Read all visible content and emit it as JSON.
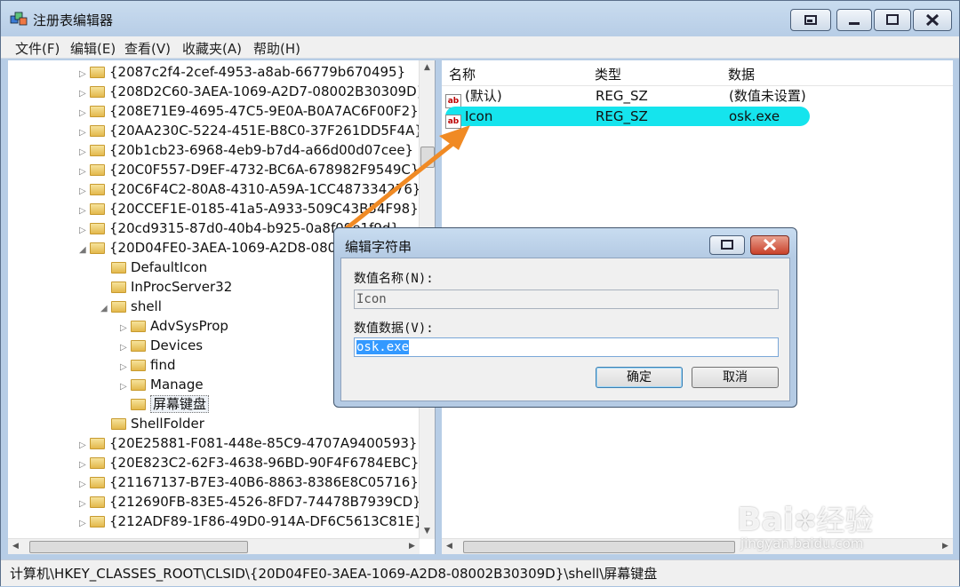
{
  "window": {
    "title": "注册表编辑器"
  },
  "menu": [
    "文件(F)",
    "编辑(E)",
    "查看(V)",
    "收藏夹(A)",
    "帮助(H)"
  ],
  "tree": [
    {
      "label": "{2087c2f4-2cef-4953-a8ab-66779b670495}",
      "level": 0,
      "arrow": "▷"
    },
    {
      "label": "{208D2C60-3AEA-1069-A2D7-08002B30309D}",
      "level": 0,
      "arrow": "▷"
    },
    {
      "label": "{208E71E9-4695-47C5-9E0A-B0A7AC6F00F2}",
      "level": 0,
      "arrow": "▷"
    },
    {
      "label": "{20AA230C-5224-451E-B8C0-37F261DD5F4A}",
      "level": 0,
      "arrow": "▷"
    },
    {
      "label": "{20b1cb23-6968-4eb9-b7d4-a66d00d07cee}",
      "level": 0,
      "arrow": "▷"
    },
    {
      "label": "{20C0F557-D9EF-4732-BC6A-678982F9549C}",
      "level": 0,
      "arrow": "▷"
    },
    {
      "label": "{20C6F4C2-80A8-4310-A59A-1CC487334276}",
      "level": 0,
      "arrow": "▷"
    },
    {
      "label": "{20CCEF1E-0185-41a5-A933-509C43B54F98}",
      "level": 0,
      "arrow": "▷"
    },
    {
      "label": "{20cd9315-87d0-40b4-b925-0a8f09e1f9d}",
      "level": 0,
      "arrow": "▷"
    },
    {
      "label": "{20D04FE0-3AEA-1069-A2D8-08002B30309D}",
      "level": 0,
      "arrow": "◢"
    },
    {
      "label": "DefaultIcon",
      "level": 1,
      "arrow": ""
    },
    {
      "label": "InProcServer32",
      "level": 1,
      "arrow": ""
    },
    {
      "label": "shell",
      "level": 1,
      "arrow": "◢"
    },
    {
      "label": "AdvSysProp",
      "level": 2,
      "arrow": "▷"
    },
    {
      "label": "Devices",
      "level": 2,
      "arrow": "▷"
    },
    {
      "label": "find",
      "level": 2,
      "arrow": "▷"
    },
    {
      "label": "Manage",
      "level": 2,
      "arrow": "▷"
    },
    {
      "label": "屏幕键盘",
      "level": 2,
      "arrow": "",
      "selected": true
    },
    {
      "label": "ShellFolder",
      "level": 1,
      "arrow": ""
    },
    {
      "label": "{20E25881-F081-448e-85C9-4707A9400593}",
      "level": 0,
      "arrow": "▷"
    },
    {
      "label": "{20E823C2-62F3-4638-96BD-90F4F6784EBC}",
      "level": 0,
      "arrow": "▷"
    },
    {
      "label": "{21167137-B7E3-40B6-8863-8386E8C05716}",
      "level": 0,
      "arrow": "▷"
    },
    {
      "label": "{212690FB-83E5-4526-8FD7-74478B7939CD}",
      "level": 0,
      "arrow": "▷"
    },
    {
      "label": "{212ADF89-1F86-49D0-914A-DF6C5613C81E}",
      "level": 0,
      "arrow": "▷"
    }
  ],
  "list": {
    "headers": {
      "name": "名称",
      "type": "类型",
      "data": "数据"
    },
    "rows": [
      {
        "name": "(默认)",
        "type": "REG_SZ",
        "data": "(数值未设置)",
        "highlight": false
      },
      {
        "name": "Icon",
        "type": "REG_SZ",
        "data": "osk.exe",
        "highlight": true
      }
    ]
  },
  "statusbar": "计算机\\HKEY_CLASSES_ROOT\\CLSID\\{20D04FE0-3AEA-1069-A2D8-08002B30309D}\\shell\\屏幕键盘",
  "dialog": {
    "title": "编辑字符串",
    "name_label": "数值名称(N):",
    "name_value": "Icon",
    "data_label": "数值数据(V):",
    "data_value": "osk.exe",
    "ok": "确定",
    "cancel": "取消"
  },
  "colors": {
    "highlight": "#15e4ed",
    "arrow": "#f08a24",
    "selection": "#3399ff"
  },
  "watermark": {
    "brand": "Bai",
    "brand2": "经验",
    "url": "jingyan.baidu.com"
  }
}
